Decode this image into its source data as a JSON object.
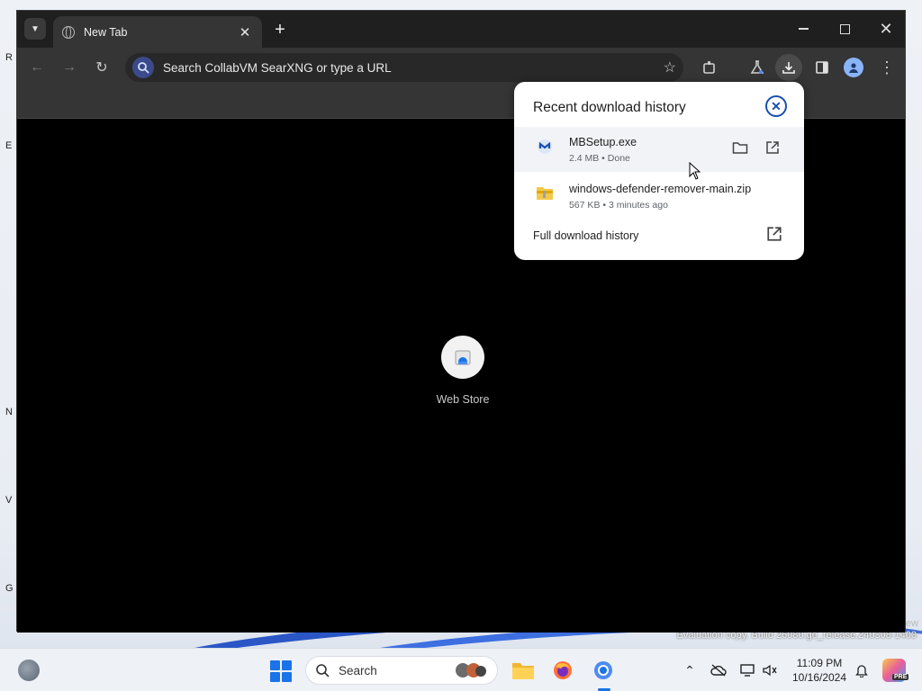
{
  "desktop": {
    "edge_glyphs": [
      "R",
      "E",
      "N",
      "V",
      "G"
    ],
    "watermark": "Evaluation copy. Build 26080.ge_release.240308-1400",
    "watermark_tail": "ew"
  },
  "browser": {
    "tab_title": "New Tab",
    "omnibox_placeholder": "Search CollabVM SearXNG or type a URL",
    "shortcut_label": "Web Store"
  },
  "downloads": {
    "title": "Recent download history",
    "items": [
      {
        "name": "MBSetup.exe",
        "meta": "2.4 MB • Done",
        "icon": "malwarebytes-icon"
      },
      {
        "name": "windows-defender-remover-main.zip",
        "meta": "567 KB • 3 minutes ago",
        "icon": "zip-folder-icon"
      }
    ],
    "full_history_label": "Full download history"
  },
  "taskbar": {
    "search_label": "Search",
    "time": "11:09 PM",
    "date": "10/16/2024",
    "copilot_badge": "PRE"
  },
  "colors": {
    "accent": "#1a73e8",
    "popup_close": "#1a4fb0"
  }
}
